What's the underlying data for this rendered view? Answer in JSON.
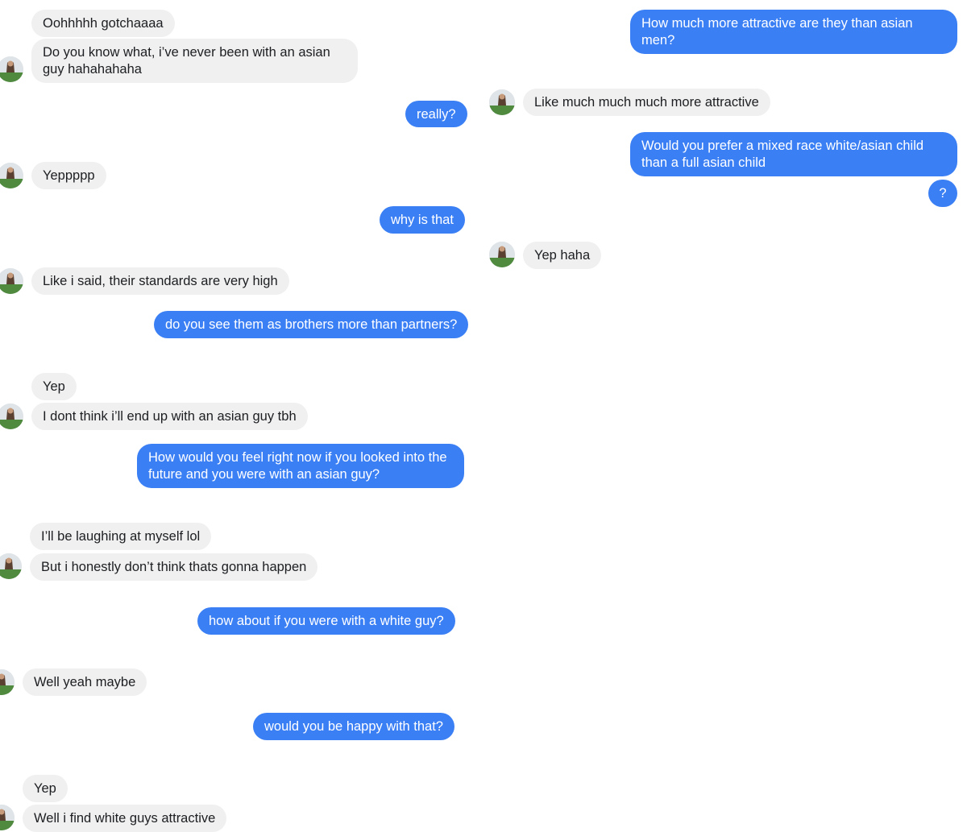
{
  "conversation": {
    "left_column": [
      {
        "id": "m1",
        "sender": "them",
        "text": "Oohhhhh gotchaaaa"
      },
      {
        "id": "m2",
        "sender": "them",
        "text": "Do you know what, i’ve never been with an asian guy hahahahaha"
      },
      {
        "id": "m3",
        "sender": "me",
        "text": "really?"
      },
      {
        "id": "m4",
        "sender": "them",
        "text": "Yeppppp"
      },
      {
        "id": "m5",
        "sender": "me",
        "text": "why is that"
      },
      {
        "id": "m6",
        "sender": "them",
        "text": "Like i said, their standards are very high"
      },
      {
        "id": "m7",
        "sender": "me",
        "text": "do you see them as brothers more than partners?"
      },
      {
        "id": "m8",
        "sender": "them",
        "text": "Yep"
      },
      {
        "id": "m9",
        "sender": "them",
        "text": "I dont think i’ll end up with an asian guy tbh"
      },
      {
        "id": "m10",
        "sender": "me",
        "text": "How would you feel right now if you looked into the future and you were with an asian guy?"
      },
      {
        "id": "m11",
        "sender": "them",
        "text": "I’ll be laughing at myself lol"
      },
      {
        "id": "m12",
        "sender": "them",
        "text": "But i honestly don’t think thats gonna happen"
      },
      {
        "id": "m13",
        "sender": "me",
        "text": "how about if you were with a white guy?"
      },
      {
        "id": "m14",
        "sender": "them",
        "text": "Well yeah maybe"
      },
      {
        "id": "m15",
        "sender": "me",
        "text": "would you be happy with that?"
      },
      {
        "id": "m16",
        "sender": "them",
        "text": "Yep"
      },
      {
        "id": "m17",
        "sender": "them",
        "text": "Well i find white guys attractive"
      }
    ],
    "right_column": [
      {
        "id": "r1",
        "sender": "me",
        "text": "How much more attractive are they than asian men?"
      },
      {
        "id": "r2",
        "sender": "them",
        "text": "Like much much much more attractive"
      },
      {
        "id": "r3",
        "sender": "me",
        "text": "Would you prefer a mixed race white/asian child than a full asian child"
      },
      {
        "id": "r4",
        "sender": "me",
        "text": "?"
      },
      {
        "id": "r5",
        "sender": "them",
        "text": "Yep haha"
      }
    ]
  },
  "colors": {
    "outgoing_bubble": "#3b7ff5",
    "incoming_bubble": "#f0f0f0",
    "incoming_text": "#1c1e21",
    "outgoing_text": "#ffffff",
    "background": "#ffffff"
  },
  "icons": {
    "contact_avatar": "contact-avatar-photo"
  }
}
